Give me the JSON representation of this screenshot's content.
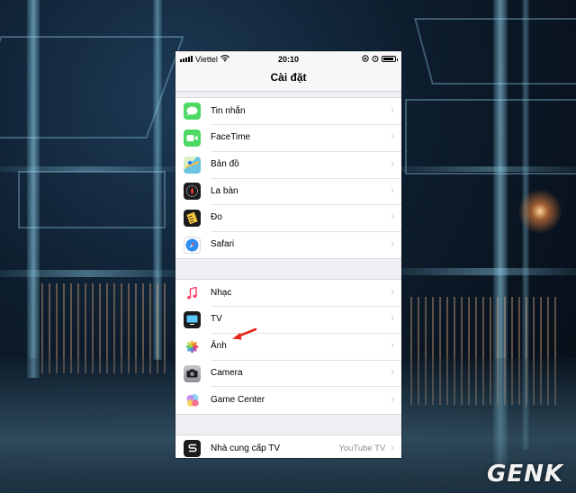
{
  "status_bar": {
    "carrier": "Viettel",
    "time": "20:10"
  },
  "nav": {
    "title": "Cài đặt"
  },
  "groups": [
    {
      "items": [
        {
          "label": "Tin nhắn",
          "icon": "messages-icon",
          "color": "#4cd964"
        },
        {
          "label": "FaceTime",
          "icon": "facetime-icon",
          "color": "#4cd964"
        },
        {
          "label": "Bản đồ",
          "icon": "maps-icon",
          "color": "#6cc3e0"
        },
        {
          "label": "La bàn",
          "icon": "compass-icon",
          "color": "#1c1c1e"
        },
        {
          "label": "Đo",
          "icon": "measure-icon",
          "color": "#1c1c1e"
        },
        {
          "label": "Safari",
          "icon": "safari-icon",
          "color": "#2f8cf0"
        }
      ]
    },
    {
      "items": [
        {
          "label": "Nhạc",
          "icon": "music-icon",
          "color": "#ffffff"
        },
        {
          "label": "TV",
          "icon": "tv-icon",
          "color": "#1c1c1e"
        },
        {
          "label": "Ảnh",
          "icon": "photos-icon",
          "color": "#ffffff"
        },
        {
          "label": "Camera",
          "icon": "camera-icon",
          "color": "#8e8e93"
        },
        {
          "label": "Game Center",
          "icon": "game-center-icon",
          "color": "#ffffff"
        }
      ]
    },
    {
      "items": [
        {
          "label": "Nhà cung cấp TV",
          "detail": "YouTube TV",
          "icon": "tv-provider-icon",
          "color": "#1c1c1e"
        }
      ]
    }
  ],
  "chevron": "›",
  "watermark": "GENK"
}
